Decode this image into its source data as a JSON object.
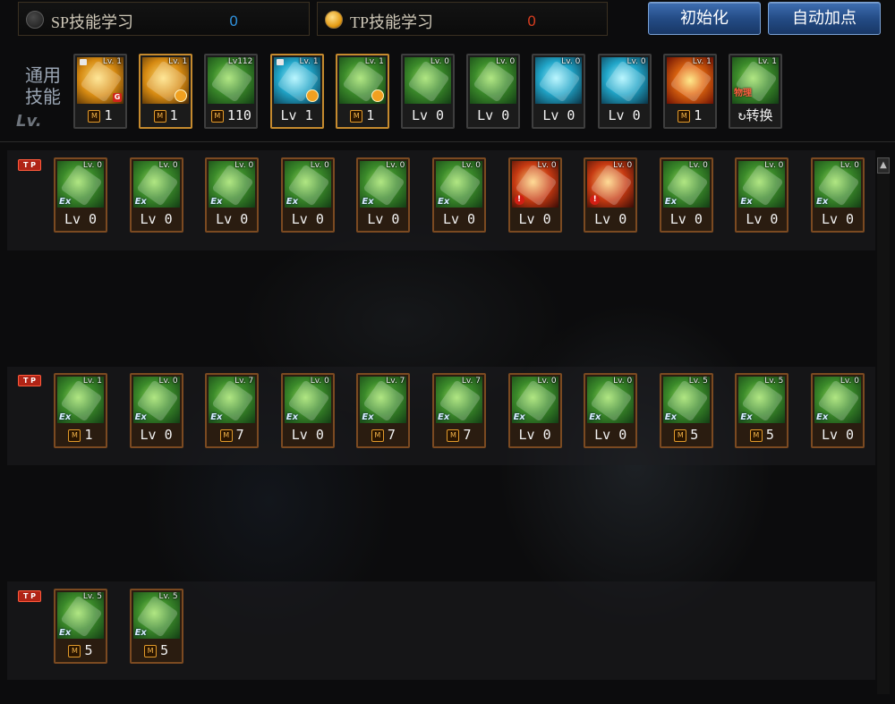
{
  "top": {
    "sp_label": "SP技能学习",
    "sp_value": "0",
    "tp_label": "TP技能学习",
    "tp_value": "0",
    "reset_button": "初始化",
    "auto_button": "自动加点"
  },
  "common": {
    "label": "通用技能",
    "lv_label": "Lv.",
    "skills": [
      {
        "icon": "gold-dash-icon",
        "top": "Lv. 1",
        "foot": "1",
        "mark": "M",
        "badge": "G",
        "lock": true
      },
      {
        "icon": "gold-run-icon",
        "top": "Lv. 1",
        "foot": "1",
        "mark": "M",
        "clock": true
      },
      {
        "icon": "green-fist-icon",
        "top": "Lv112",
        "foot": "110",
        "mark": "M"
      },
      {
        "icon": "cyan-wing-icon",
        "top": "Lv. 1",
        "foot": "Lv 1",
        "lock": true,
        "clock": true
      },
      {
        "icon": "green-arm-icon",
        "top": "Lv. 1",
        "foot": "1",
        "mark": "M",
        "clock": true
      },
      {
        "icon": "green-target-icon",
        "top": "Lv. 0",
        "foot": "Lv 0"
      },
      {
        "icon": "green-figure-icon",
        "top": "Lv. 0",
        "foot": "Lv 0"
      },
      {
        "icon": "cyan-eye-icon",
        "top": "Lv. 0",
        "foot": "Lv 0"
      },
      {
        "icon": "cyan-body-icon",
        "top": "Lv. 0",
        "foot": "Lv 0"
      },
      {
        "icon": "fire-burst-icon",
        "top": "Lv. 1",
        "foot": "1",
        "mark": "M"
      },
      {
        "icon": "green-convert-icon",
        "top": "Lv. 1",
        "foot": "转换",
        "convert": "物理",
        "convert_prefix": "↻"
      }
    ]
  },
  "rows": [
    {
      "tag": "T P",
      "skills": [
        {
          "icon": "green-kick-icon",
          "top": "Lv. 0",
          "foot": "Lv 0",
          "ex": "Ex"
        },
        {
          "icon": "green-claw-icon",
          "top": "Lv. 0",
          "foot": "Lv 0",
          "ex": "Ex"
        },
        {
          "icon": "green-boot-icon",
          "top": "Lv. 0",
          "foot": "Lv 0",
          "ex": "Ex"
        },
        {
          "icon": "green-strike-icon",
          "top": "Lv. 0",
          "foot": "Lv 0",
          "ex": "Ex"
        },
        {
          "icon": "green-gear-icon",
          "top": "Lv. 0",
          "foot": "Lv 0",
          "ex": "Ex"
        },
        {
          "icon": "green-arrow-icon",
          "top": "Lv. 0",
          "foot": "Lv 0",
          "ex": "Ex"
        },
        {
          "icon": "red-hammer-icon",
          "top": "Lv. 0",
          "foot": "Lv 0",
          "warn": "!"
        },
        {
          "icon": "red-spike-icon",
          "top": "Lv. 0",
          "foot": "Lv 0",
          "warn": "!"
        },
        {
          "icon": "green-swords-icon",
          "top": "Lv. 0",
          "foot": "Lv 0",
          "ex": "Ex"
        },
        {
          "icon": "green-swirl-icon",
          "top": "Lv. 0",
          "foot": "Lv 0",
          "ex": "Ex"
        },
        {
          "icon": "green-blast-icon",
          "top": "Lv. 0",
          "foot": "Lv 0",
          "ex": "Ex"
        }
      ]
    },
    {
      "tag": "T P",
      "skills": [
        {
          "icon": "green-kick2-icon",
          "top": "Lv. 1",
          "foot": "1",
          "mark": "M",
          "ex": "Ex"
        },
        {
          "icon": "green-spin-icon",
          "top": "Lv. 0",
          "foot": "Lv 0",
          "ex": "Ex"
        },
        {
          "icon": "green-shield-icon",
          "top": "Lv. 7",
          "foot": "7",
          "mark": "M",
          "ex": "Ex"
        },
        {
          "icon": "green-slash-icon",
          "top": "Lv. 0",
          "foot": "Lv 0",
          "ex": "Ex"
        },
        {
          "icon": "green-lance-icon",
          "top": "Lv. 7",
          "foot": "7",
          "mark": "M",
          "ex": "Ex"
        },
        {
          "icon": "green-blade-icon",
          "top": "Lv. 7",
          "foot": "7",
          "mark": "M",
          "ex": "Ex"
        },
        {
          "icon": "green-guard-icon",
          "top": "Lv. 0",
          "foot": "Lv 0",
          "ex": "Ex"
        },
        {
          "icon": "green-burst-icon",
          "top": "Lv. 0",
          "foot": "Lv 0",
          "ex": "Ex"
        },
        {
          "icon": "green-vine-icon",
          "top": "Lv. 5",
          "foot": "5",
          "mark": "M",
          "ex": "Ex"
        },
        {
          "icon": "green-horn-icon",
          "top": "Lv. 5",
          "foot": "5",
          "mark": "M",
          "ex": "Ex"
        },
        {
          "icon": "green-cross-icon",
          "top": "Lv. 0",
          "foot": "Lv 0",
          "ex": "Ex"
        }
      ]
    },
    {
      "tag": "T P",
      "skills": [
        {
          "icon": "green-sprout-icon",
          "top": "Lv. 5",
          "foot": "5",
          "mark": "M",
          "ex": "Ex"
        },
        {
          "icon": "green-aegis-icon",
          "top": "Lv. 5",
          "foot": "5",
          "mark": "M",
          "ex": "Ex"
        }
      ]
    }
  ],
  "scroll_up_glyph": "▲"
}
